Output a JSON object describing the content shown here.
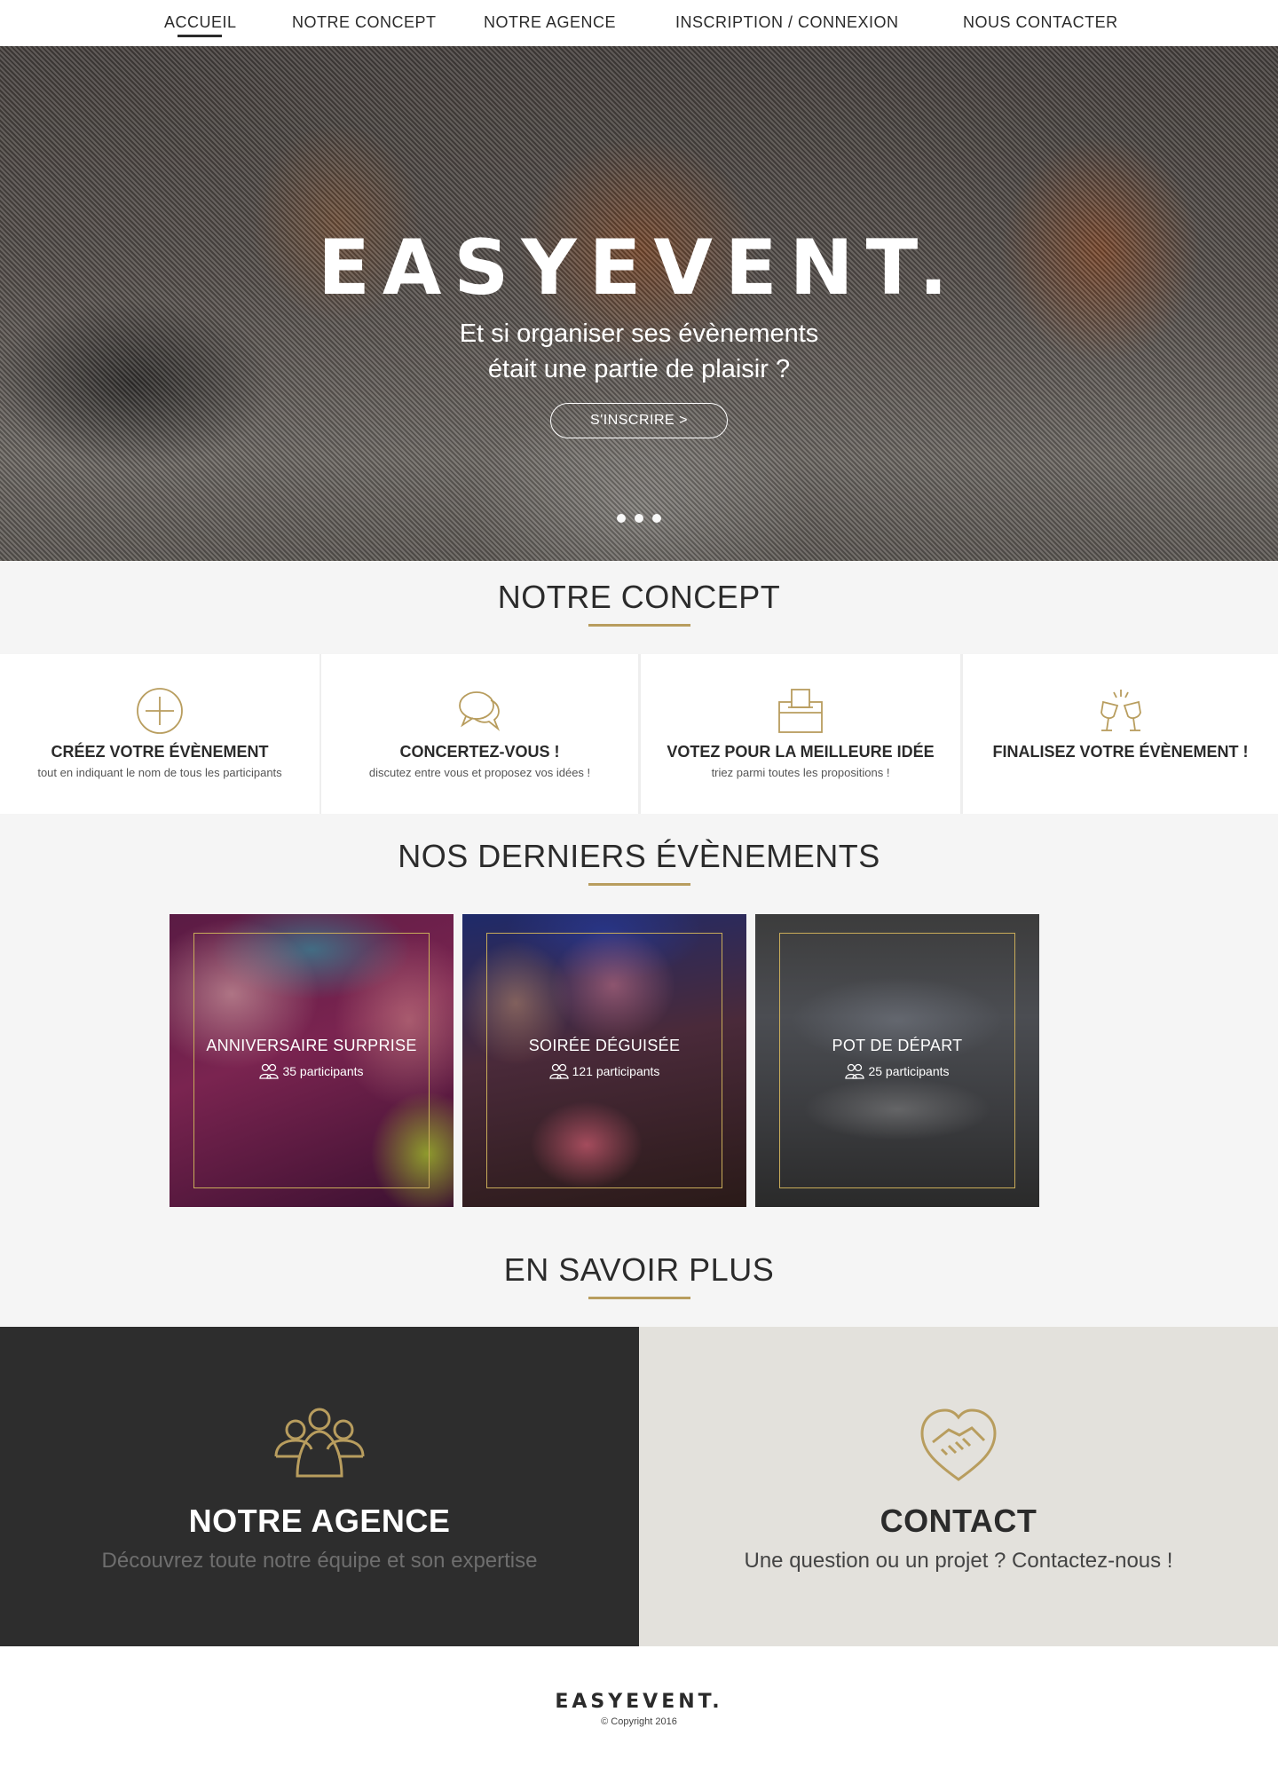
{
  "nav": {
    "items": [
      {
        "label": "ACCUEIL"
      },
      {
        "label": "NOTRE CONCEPT"
      },
      {
        "label": "NOTRE AGENCE"
      },
      {
        "label": "INSCRIPTION / CONNEXION"
      },
      {
        "label": "NOUS CONTACTER"
      }
    ],
    "active_index": 0
  },
  "hero": {
    "title": "EASYEVENT.",
    "subtitle_line1": "Et si organiser ses évènements",
    "subtitle_line2": "était une partie de plaisir ?",
    "button_label": "S'INSCRIRE >",
    "slides_count": 3
  },
  "concept": {
    "title": "NOTRE CONCEPT",
    "cards": [
      {
        "icon": "plus-circle-icon",
        "title": "CRÉEZ VOTRE ÉVÈNEMENT",
        "desc": "tout en indiquant le nom de tous les participants"
      },
      {
        "icon": "chat-bubbles-icon",
        "title": "CONCERTEZ-VOUS !",
        "desc": "discutez entre vous et proposez vos idées !"
      },
      {
        "icon": "ballot-box-icon",
        "title": "VOTEZ POUR LA MEILLEURE IDÉE",
        "desc": "triez parmi toutes les propositions !"
      },
      {
        "icon": "toast-glasses-icon",
        "title": "FINALISEZ VOTRE ÉVÈNEMENT !",
        "desc": ""
      }
    ]
  },
  "events": {
    "title": "NOS DERNIERS ÉVÈNEMENTS",
    "items": [
      {
        "name": "ANNIVERSAIRE SURPRISE",
        "participants": "35 participants"
      },
      {
        "name": "SOIRÉE DÉGUISÉE",
        "participants": "121 participants"
      },
      {
        "name": "POT DE DÉPART",
        "participants": "25 participants"
      }
    ]
  },
  "more": {
    "title": "EN SAVOIR PLUS",
    "agence": {
      "icon": "team-icon",
      "title": "NOTRE AGENCE",
      "text": "Découvrez toute notre équipe et son expertise"
    },
    "contact": {
      "icon": "handshake-icon",
      "title": "CONTACT",
      "text": "Une question ou un projet ? Contactez-nous !"
    }
  },
  "footer": {
    "logo": "EASYEVENT.",
    "copyright": "© Copyright 2016"
  },
  "colors": {
    "accent": "#b89d5e",
    "dark": "#2d2d2d",
    "light_panel": "#e3e1dc",
    "section_bg": "#f5f5f5"
  }
}
